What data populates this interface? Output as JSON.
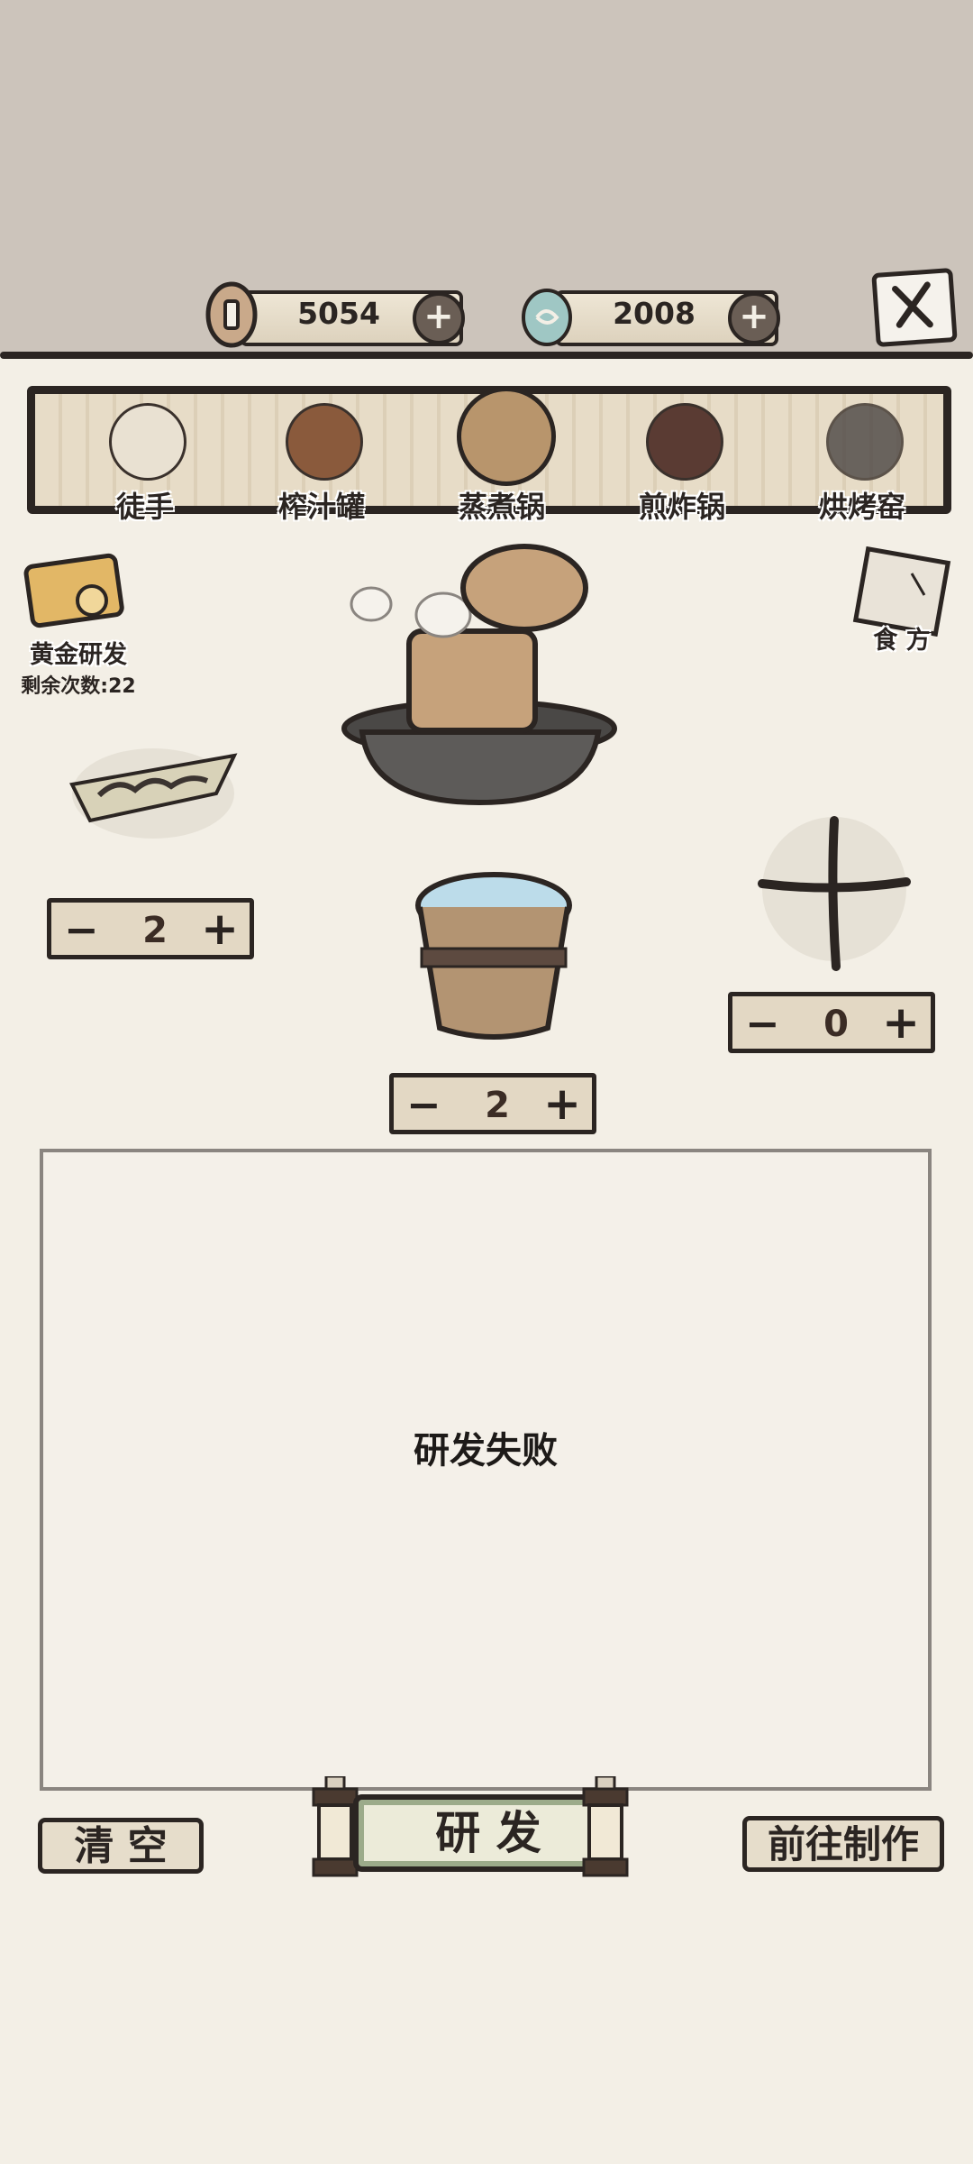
{
  "currency": {
    "coins": "5054",
    "gems": "2008"
  },
  "tools": [
    {
      "label": "徒手",
      "icon": "hand-herb-icon"
    },
    {
      "label": "榨汁罐",
      "icon": "juice-barrel-icon"
    },
    {
      "label": "蒸煮锅",
      "icon": "steamer-pot-icon",
      "selected": true
    },
    {
      "label": "煎炸锅",
      "icon": "frying-pan-icon"
    },
    {
      "label": "烘烤窑",
      "icon": "oven-kiln-icon"
    }
  ],
  "golden": {
    "label": "黄金研发",
    "remaining": "剩余次数:22"
  },
  "recipe": {
    "label": "食 方"
  },
  "ingredients": {
    "left": {
      "count": "2"
    },
    "water": {
      "count": "2"
    },
    "right": {
      "count": "0"
    }
  },
  "result": {
    "text": "研发失败"
  },
  "buttons": {
    "clear": "清 空",
    "develop": "研 发",
    "goto_make": "前往制作"
  }
}
